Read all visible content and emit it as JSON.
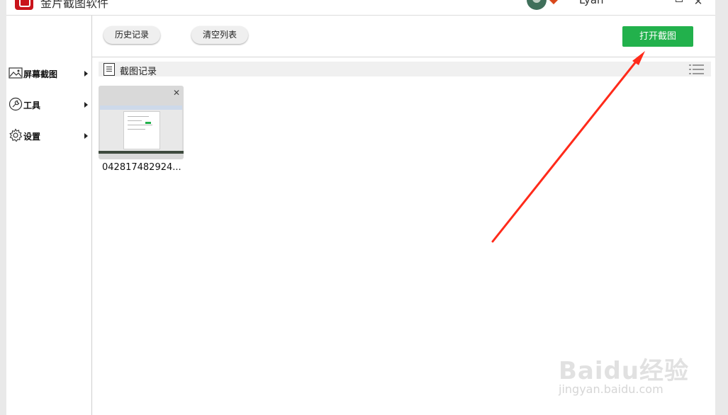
{
  "app": {
    "title": "金片截图软件",
    "username": "Lyan"
  },
  "sidebar": {
    "items": [
      {
        "label": "屏幕截图",
        "icon": "image-icon"
      },
      {
        "label": "工具",
        "icon": "wrench-icon"
      },
      {
        "label": "设置",
        "icon": "gear-icon"
      }
    ]
  },
  "toolbar": {
    "history_label": "历史记录",
    "clear_label": "清空列表",
    "open_label": "打开截图"
  },
  "records": {
    "title": "截图记录",
    "items": [
      {
        "name": "042817482924..."
      }
    ]
  },
  "colors": {
    "accent_green": "#22b14c",
    "logo_red": "#c9141b",
    "annotation_red": "#ff2a1a"
  },
  "watermark": {
    "brand": "Baidu经验",
    "url": "jingyan.baidu.com"
  }
}
